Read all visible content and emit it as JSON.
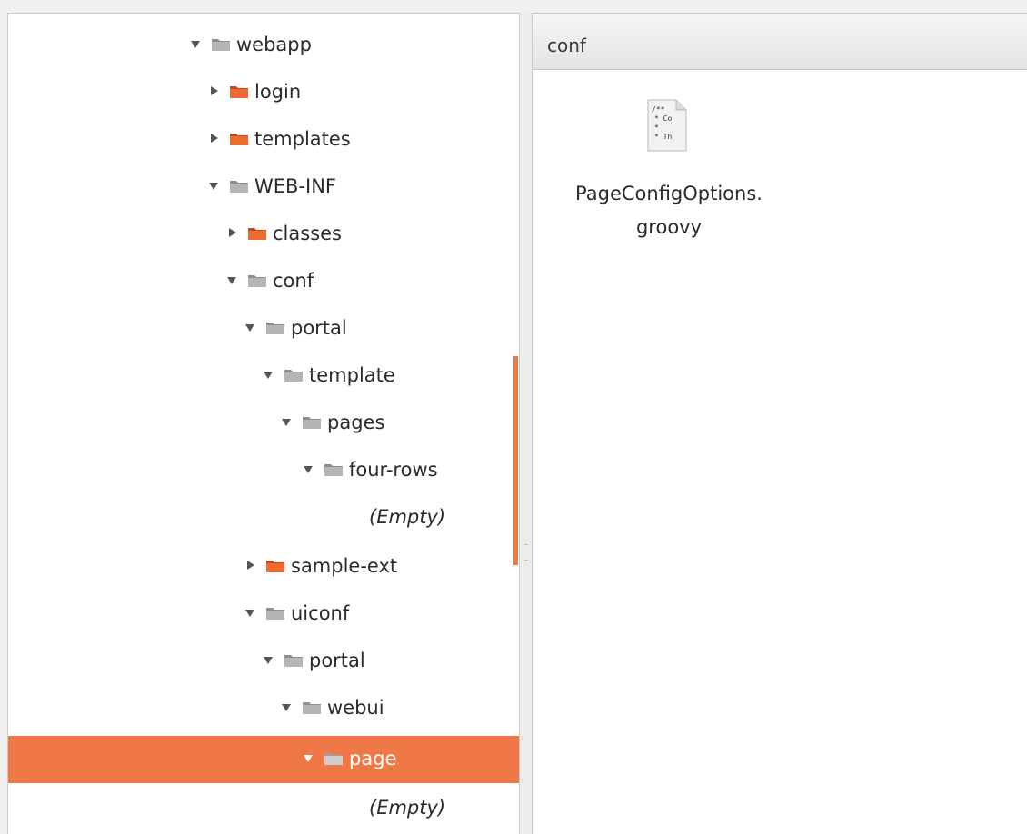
{
  "tree": {
    "items": [
      {
        "label": "webapp",
        "state": "open",
        "folder": "gray"
      },
      {
        "label": "login",
        "state": "closed",
        "folder": "orange"
      },
      {
        "label": "templates",
        "state": "closed",
        "folder": "orange"
      },
      {
        "label": "WEB-INF",
        "state": "open",
        "folder": "gray"
      },
      {
        "label": "classes",
        "state": "closed",
        "folder": "orange"
      },
      {
        "label": "conf",
        "state": "open",
        "folder": "gray"
      },
      {
        "label": "portal",
        "state": "open",
        "folder": "gray"
      },
      {
        "label": "template",
        "state": "open",
        "folder": "gray"
      },
      {
        "label": "pages",
        "state": "open",
        "folder": "gray"
      },
      {
        "label": "four-rows",
        "state": "open",
        "folder": "gray"
      },
      {
        "label": "(Empty)",
        "state": "empty",
        "folder": "none"
      },
      {
        "label": "sample-ext",
        "state": "closed",
        "folder": "orange"
      },
      {
        "label": "uiconf",
        "state": "open",
        "folder": "gray"
      },
      {
        "label": "portal",
        "state": "open",
        "folder": "gray"
      },
      {
        "label": "webui",
        "state": "open",
        "folder": "gray"
      },
      {
        "label": "page",
        "state": "open",
        "folder": "gray",
        "selected": true
      },
      {
        "label": "(Empty)",
        "state": "empty",
        "folder": "none"
      }
    ]
  },
  "location": {
    "path": "conf"
  },
  "files": [
    {
      "name_line1": "PageConfigOptions.",
      "name_line2": "groovy",
      "icon": "text-file-icon",
      "preview": [
        "/**",
        "* Co",
        "*",
        "* Th"
      ]
    }
  ],
  "colors": {
    "accent": "#f07746",
    "folder_gray": "#9a9a9a",
    "folder_orange": "#e8632f"
  }
}
